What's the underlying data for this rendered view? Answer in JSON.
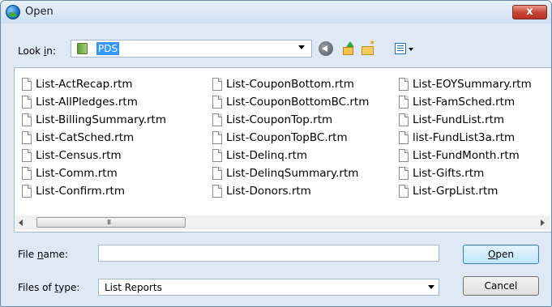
{
  "window": {
    "title": "Open",
    "close_label": "x"
  },
  "toolbar": {
    "look_in_label_prefix": "Look ",
    "look_in_label_accel": "i",
    "look_in_label_suffix": "n:",
    "look_in_value": "PDS",
    "icons": [
      "back-icon",
      "up-folder-icon",
      "new-folder-icon",
      "views-menu-icon"
    ]
  },
  "files": [
    "List-ActRecap.rtm",
    "List-AllPledges.rtm",
    "List-BillingSummary.rtm",
    "List-CatSched.rtm",
    "List-Census.rtm",
    "List-Comm.rtm",
    "List-Confirm.rtm",
    "List-CouponBottom.rtm",
    "List-CouponBottomBC.rtm",
    "List-CouponTop.rtm",
    "List-CouponTopBC.rtm",
    "List-Delinq.rtm",
    "List-DelinqSummary.rtm",
    "List-Donors.rtm",
    "List-EOYSummary.rtm",
    "List-FamSched.rtm",
    "List-FundList.rtm",
    "list-FundList3a.rtm",
    "List-FundMonth.rtm",
    "List-Gifts.rtm",
    "List-GrpList.rtm"
  ],
  "scrollbar": {
    "grip": "III"
  },
  "form": {
    "file_name_label_prefix": "File ",
    "file_name_label_accel": "n",
    "file_name_label_suffix": "ame:",
    "file_name_value": "",
    "file_type_label_prefix": "Files of ",
    "file_type_label_accel": "t",
    "file_type_label_suffix": "ype:",
    "file_type_value": "List Reports"
  },
  "buttons": {
    "open_accel": "O",
    "open_rest": "pen",
    "cancel": "Cancel"
  },
  "colors": {
    "selection": "#3399ff",
    "close_button": "#c9463a",
    "frame": "#dfe9f5"
  }
}
